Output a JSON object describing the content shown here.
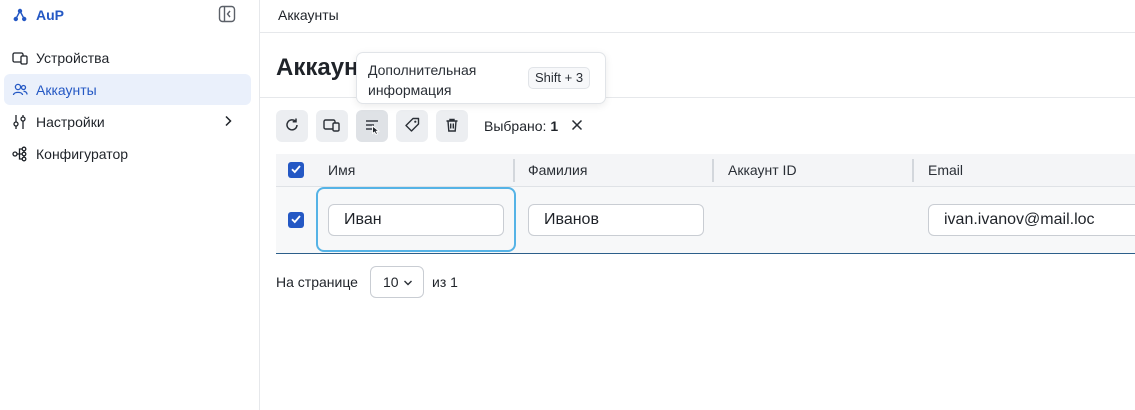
{
  "app": {
    "name": "AuP"
  },
  "sidebar": {
    "items": [
      {
        "label": "Устройства",
        "active": false
      },
      {
        "label": "Аккаунты",
        "active": true
      },
      {
        "label": "Настройки",
        "active": false
      },
      {
        "label": "Конфигуратор",
        "active": false
      }
    ]
  },
  "header": {
    "breadcrumb": "Аккаунты"
  },
  "page": {
    "title": "Аккаунты"
  },
  "tooltip": {
    "text": "Дополнительная информация",
    "shortcut": "Shift + 3"
  },
  "toolbar": {
    "selected_label": "Выбрано:",
    "selected_count": "1"
  },
  "table": {
    "headers": [
      "Имя",
      "Фамилия",
      "Аккаунт ID",
      "Email"
    ],
    "rows": [
      {
        "first_name": "Иван",
        "last_name": "Иванов",
        "account_id": "",
        "email": "ivan.ivanov@mail.loc",
        "checked": true
      }
    ]
  },
  "pagination": {
    "per_page_label": "На странице",
    "per_page": "10",
    "of_label": "из 1"
  },
  "colors": {
    "accent": "#2458c4",
    "focus": "#55b3e6",
    "active_bg": "#eaf0fb"
  }
}
